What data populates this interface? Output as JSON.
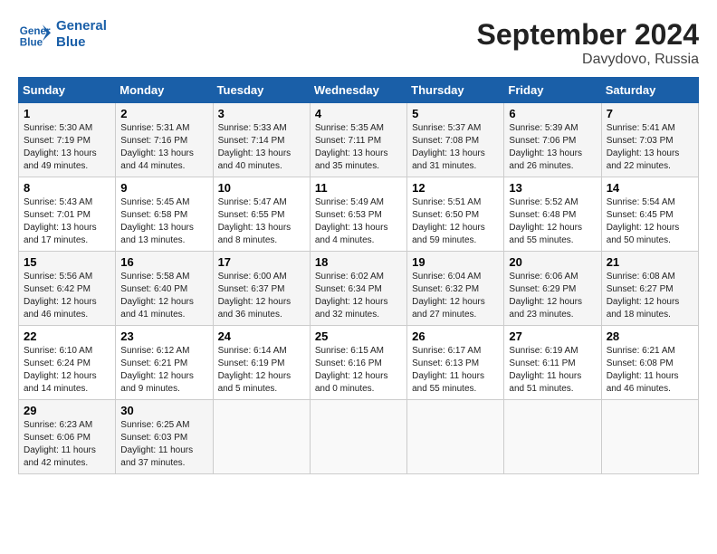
{
  "logo": {
    "text_general": "General",
    "text_blue": "Blue"
  },
  "title": "September 2024",
  "location": "Davydovo, Russia",
  "days_of_week": [
    "Sunday",
    "Monday",
    "Tuesday",
    "Wednesday",
    "Thursday",
    "Friday",
    "Saturday"
  ],
  "weeks": [
    [
      {
        "day": "1",
        "sunrise": "Sunrise: 5:30 AM",
        "sunset": "Sunset: 7:19 PM",
        "daylight": "Daylight: 13 hours and 49 minutes."
      },
      {
        "day": "2",
        "sunrise": "Sunrise: 5:31 AM",
        "sunset": "Sunset: 7:16 PM",
        "daylight": "Daylight: 13 hours and 44 minutes."
      },
      {
        "day": "3",
        "sunrise": "Sunrise: 5:33 AM",
        "sunset": "Sunset: 7:14 PM",
        "daylight": "Daylight: 13 hours and 40 minutes."
      },
      {
        "day": "4",
        "sunrise": "Sunrise: 5:35 AM",
        "sunset": "Sunset: 7:11 PM",
        "daylight": "Daylight: 13 hours and 35 minutes."
      },
      {
        "day": "5",
        "sunrise": "Sunrise: 5:37 AM",
        "sunset": "Sunset: 7:08 PM",
        "daylight": "Daylight: 13 hours and 31 minutes."
      },
      {
        "day": "6",
        "sunrise": "Sunrise: 5:39 AM",
        "sunset": "Sunset: 7:06 PM",
        "daylight": "Daylight: 13 hours and 26 minutes."
      },
      {
        "day": "7",
        "sunrise": "Sunrise: 5:41 AM",
        "sunset": "Sunset: 7:03 PM",
        "daylight": "Daylight: 13 hours and 22 minutes."
      }
    ],
    [
      {
        "day": "8",
        "sunrise": "Sunrise: 5:43 AM",
        "sunset": "Sunset: 7:01 PM",
        "daylight": "Daylight: 13 hours and 17 minutes."
      },
      {
        "day": "9",
        "sunrise": "Sunrise: 5:45 AM",
        "sunset": "Sunset: 6:58 PM",
        "daylight": "Daylight: 13 hours and 13 minutes."
      },
      {
        "day": "10",
        "sunrise": "Sunrise: 5:47 AM",
        "sunset": "Sunset: 6:55 PM",
        "daylight": "Daylight: 13 hours and 8 minutes."
      },
      {
        "day": "11",
        "sunrise": "Sunrise: 5:49 AM",
        "sunset": "Sunset: 6:53 PM",
        "daylight": "Daylight: 13 hours and 4 minutes."
      },
      {
        "day": "12",
        "sunrise": "Sunrise: 5:51 AM",
        "sunset": "Sunset: 6:50 PM",
        "daylight": "Daylight: 12 hours and 59 minutes."
      },
      {
        "day": "13",
        "sunrise": "Sunrise: 5:52 AM",
        "sunset": "Sunset: 6:48 PM",
        "daylight": "Daylight: 12 hours and 55 minutes."
      },
      {
        "day": "14",
        "sunrise": "Sunrise: 5:54 AM",
        "sunset": "Sunset: 6:45 PM",
        "daylight": "Daylight: 12 hours and 50 minutes."
      }
    ],
    [
      {
        "day": "15",
        "sunrise": "Sunrise: 5:56 AM",
        "sunset": "Sunset: 6:42 PM",
        "daylight": "Daylight: 12 hours and 46 minutes."
      },
      {
        "day": "16",
        "sunrise": "Sunrise: 5:58 AM",
        "sunset": "Sunset: 6:40 PM",
        "daylight": "Daylight: 12 hours and 41 minutes."
      },
      {
        "day": "17",
        "sunrise": "Sunrise: 6:00 AM",
        "sunset": "Sunset: 6:37 PM",
        "daylight": "Daylight: 12 hours and 36 minutes."
      },
      {
        "day": "18",
        "sunrise": "Sunrise: 6:02 AM",
        "sunset": "Sunset: 6:34 PM",
        "daylight": "Daylight: 12 hours and 32 minutes."
      },
      {
        "day": "19",
        "sunrise": "Sunrise: 6:04 AM",
        "sunset": "Sunset: 6:32 PM",
        "daylight": "Daylight: 12 hours and 27 minutes."
      },
      {
        "day": "20",
        "sunrise": "Sunrise: 6:06 AM",
        "sunset": "Sunset: 6:29 PM",
        "daylight": "Daylight: 12 hours and 23 minutes."
      },
      {
        "day": "21",
        "sunrise": "Sunrise: 6:08 AM",
        "sunset": "Sunset: 6:27 PM",
        "daylight": "Daylight: 12 hours and 18 minutes."
      }
    ],
    [
      {
        "day": "22",
        "sunrise": "Sunrise: 6:10 AM",
        "sunset": "Sunset: 6:24 PM",
        "daylight": "Daylight: 12 hours and 14 minutes."
      },
      {
        "day": "23",
        "sunrise": "Sunrise: 6:12 AM",
        "sunset": "Sunset: 6:21 PM",
        "daylight": "Daylight: 12 hours and 9 minutes."
      },
      {
        "day": "24",
        "sunrise": "Sunrise: 6:14 AM",
        "sunset": "Sunset: 6:19 PM",
        "daylight": "Daylight: 12 hours and 5 minutes."
      },
      {
        "day": "25",
        "sunrise": "Sunrise: 6:15 AM",
        "sunset": "Sunset: 6:16 PM",
        "daylight": "Daylight: 12 hours and 0 minutes."
      },
      {
        "day": "26",
        "sunrise": "Sunrise: 6:17 AM",
        "sunset": "Sunset: 6:13 PM",
        "daylight": "Daylight: 11 hours and 55 minutes."
      },
      {
        "day": "27",
        "sunrise": "Sunrise: 6:19 AM",
        "sunset": "Sunset: 6:11 PM",
        "daylight": "Daylight: 11 hours and 51 minutes."
      },
      {
        "day": "28",
        "sunrise": "Sunrise: 6:21 AM",
        "sunset": "Sunset: 6:08 PM",
        "daylight": "Daylight: 11 hours and 46 minutes."
      }
    ],
    [
      {
        "day": "29",
        "sunrise": "Sunrise: 6:23 AM",
        "sunset": "Sunset: 6:06 PM",
        "daylight": "Daylight: 11 hours and 42 minutes."
      },
      {
        "day": "30",
        "sunrise": "Sunrise: 6:25 AM",
        "sunset": "Sunset: 6:03 PM",
        "daylight": "Daylight: 11 hours and 37 minutes."
      },
      null,
      null,
      null,
      null,
      null
    ]
  ]
}
